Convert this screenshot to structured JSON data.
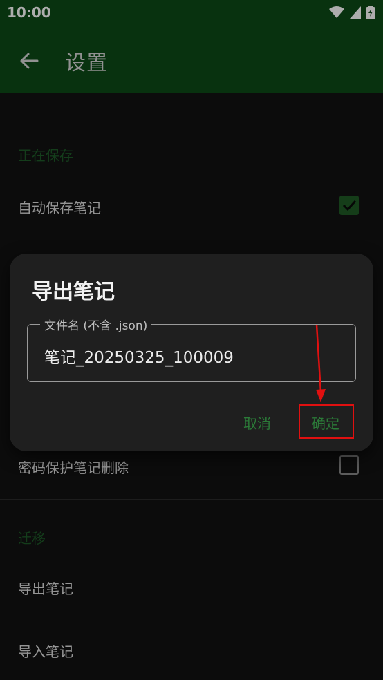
{
  "status_bar": {
    "time": "10:00"
  },
  "app_bar": {
    "title": "设置"
  },
  "sections": {
    "saving": {
      "header": "正在保存",
      "items": [
        {
          "label": "自动保存笔记",
          "checked": true
        }
      ]
    },
    "security": {
      "items": [
        {
          "label": "密码保护笔记删除",
          "checked": false
        }
      ]
    },
    "migration": {
      "header": "迁移",
      "items": [
        {
          "label": "导出笔记"
        },
        {
          "label": "导入笔记"
        }
      ]
    }
  },
  "dialog": {
    "title": "导出笔记",
    "field_label": "文件名 (不含 .json)",
    "field_value": "笔记_20250325_100009",
    "cancel_label": "取消",
    "confirm_label": "确定"
  },
  "colors": {
    "app_bar": "#0c4a17",
    "accent": "#2b7a38",
    "annotation": "#e01010"
  },
  "icons": [
    "back-arrow-icon",
    "wifi-icon",
    "signal-icon",
    "battery-icon",
    "check-icon"
  ]
}
